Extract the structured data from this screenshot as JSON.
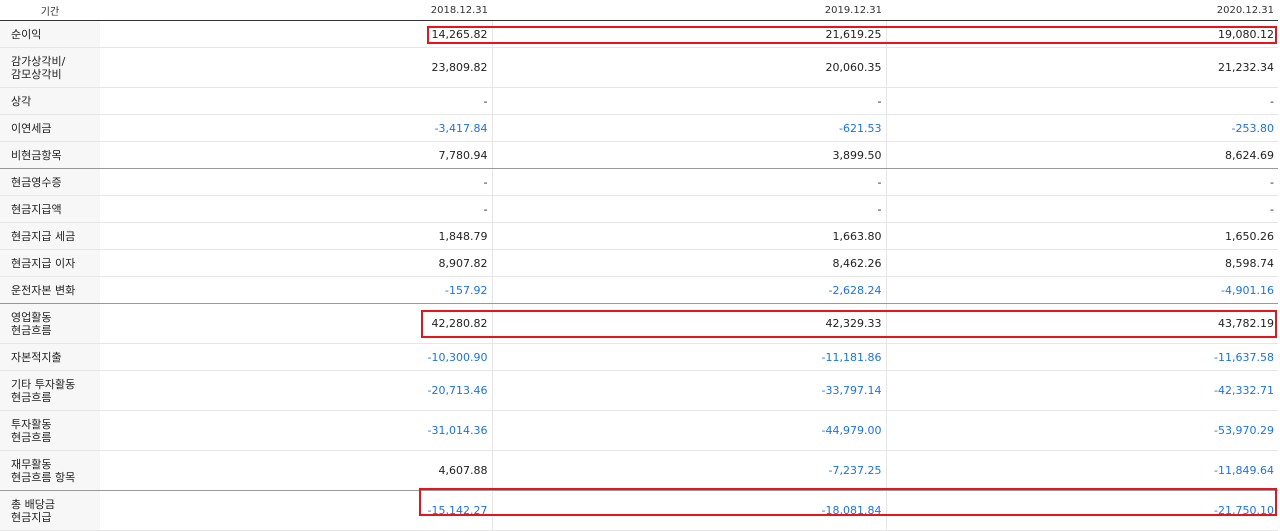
{
  "header": {
    "label": "기간",
    "periods": [
      "2018.12.31",
      "2019.12.31",
      "2020.12.31"
    ]
  },
  "rows": [
    {
      "label": "순이익",
      "values": [
        "14,265.82",
        "21,619.25",
        "19,080.12"
      ],
      "neg": [
        false,
        false,
        false
      ]
    },
    {
      "label": "감가상각비/\n감모상각비",
      "values": [
        "23,809.82",
        "20,060.35",
        "21,232.34"
      ],
      "neg": [
        false,
        false,
        false
      ]
    },
    {
      "label": "상각",
      "values": [
        "-",
        "-",
        "-"
      ],
      "neg": [
        false,
        false,
        false
      ]
    },
    {
      "label": "이연세금",
      "values": [
        "-3,417.84",
        "-621.53",
        "-253.80"
      ],
      "neg": [
        true,
        true,
        true
      ]
    },
    {
      "label": "비현금항목",
      "values": [
        "7,780.94",
        "3,899.50",
        "8,624.69"
      ],
      "neg": [
        false,
        false,
        false
      ]
    },
    {
      "label": "현금영수증",
      "values": [
        "-",
        "-",
        "-"
      ],
      "neg": [
        false,
        false,
        false
      ]
    },
    {
      "label": "현금지급액",
      "values": [
        "-",
        "-",
        "-"
      ],
      "neg": [
        false,
        false,
        false
      ]
    },
    {
      "label": "현금지급 세금",
      "values": [
        "1,848.79",
        "1,663.80",
        "1,650.26"
      ],
      "neg": [
        false,
        false,
        false
      ]
    },
    {
      "label": "현금지급 이자",
      "values": [
        "8,907.82",
        "8,462.26",
        "8,598.74"
      ],
      "neg": [
        false,
        false,
        false
      ]
    },
    {
      "label": "운전자본 변화",
      "values": [
        "-157.92",
        "-2,628.24",
        "-4,901.16"
      ],
      "neg": [
        true,
        true,
        true
      ]
    },
    {
      "label": "영업활동\n현금흐름",
      "values": [
        "42,280.82",
        "42,329.33",
        "43,782.19"
      ],
      "neg": [
        false,
        false,
        false
      ]
    },
    {
      "label": "자본적지출",
      "values": [
        "-10,300.90",
        "-11,181.86",
        "-11,637.58"
      ],
      "neg": [
        true,
        true,
        true
      ]
    },
    {
      "label": "기타 투자활동\n현금흐름",
      "values": [
        "-20,713.46",
        "-33,797.14",
        "-42,332.71"
      ],
      "neg": [
        true,
        true,
        true
      ]
    },
    {
      "label": "투자활동\n현금흐름",
      "values": [
        "-31,014.36",
        "-44,979.00",
        "-53,970.29"
      ],
      "neg": [
        true,
        true,
        true
      ]
    },
    {
      "label": "재무활동\n현금흐름 항목",
      "values": [
        "4,607.88",
        "-7,237.25",
        "-11,849.64"
      ],
      "neg": [
        false,
        true,
        true
      ]
    },
    {
      "label": "총 배당금\n현금지급",
      "values": [
        "-15,142.27",
        "-18,081.84",
        "-21,750.10"
      ],
      "neg": [
        true,
        true,
        true
      ]
    }
  ]
}
